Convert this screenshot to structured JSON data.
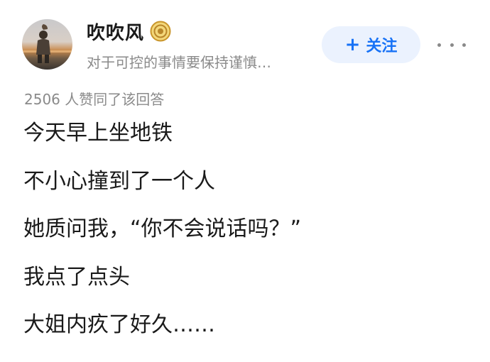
{
  "author": {
    "name": "吹吹风",
    "bio": "对于可控的事情要保持谨慎…",
    "badge_icon": "gold-medal-icon",
    "avatar_icon": "person-at-sunset-avatar"
  },
  "actions": {
    "follow_plus": "+",
    "follow_label": "关注",
    "more_icon": "more-horizontal-icon"
  },
  "answer": {
    "vote_summary": "2506 人赞同了该回答",
    "lines": [
      "今天早上坐地铁",
      "不小心撞到了一个人",
      "她质问我，“你不会说话吗？”",
      "我点了点头",
      "大姐内疚了好久……"
    ]
  },
  "colors": {
    "accent": "#1772f6",
    "accent_bg": "#ebf2fe",
    "muted_text": "#8a8a8a",
    "badge_gold": "#d9a93a"
  }
}
